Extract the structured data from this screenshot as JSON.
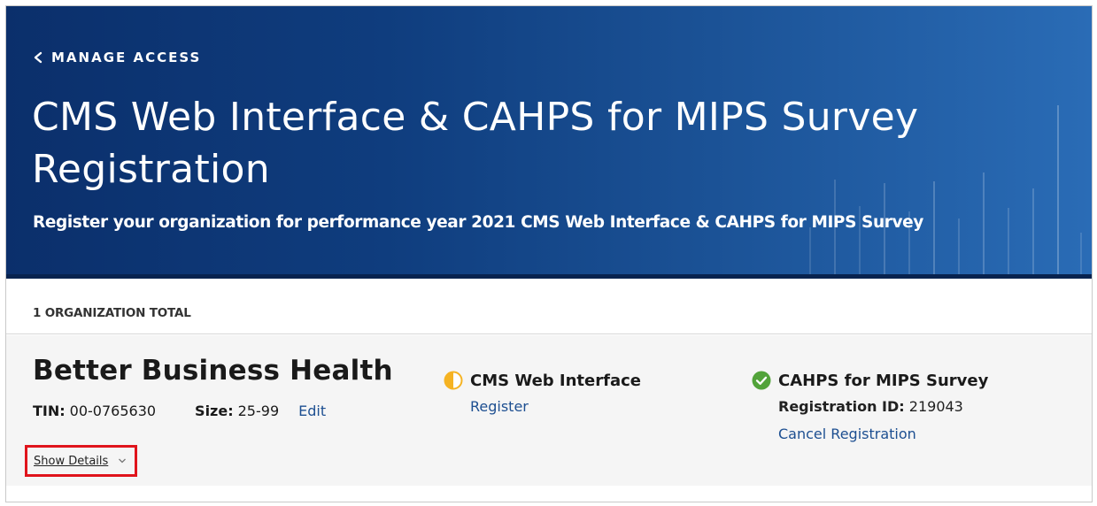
{
  "header": {
    "back_link": "MANAGE ACCESS",
    "title": "CMS Web Interface & CAHPS for MIPS Survey Registration",
    "subtitle": "Register your organization for performance year 2021 CMS Web Interface & CAHPS for MIPS Survey",
    "back_icon": "chevron-left-icon"
  },
  "summary": {
    "total_label": "1 ORGANIZATION TOTAL"
  },
  "organization": {
    "name": "Better Business Health",
    "tin_label": "TIN:",
    "tin_value": "00-0765630",
    "size_label": "Size:",
    "size_value": "25-99",
    "edit_label": "Edit",
    "show_details_label": "Show Details",
    "programs": [
      {
        "name": "CMS Web Interface",
        "status": "in-progress",
        "status_icon": "half-circle-icon",
        "status_color": "#f5b323",
        "action_label": "Register"
      },
      {
        "name": "CAHPS for MIPS Survey",
        "status": "registered",
        "status_icon": "check-circle-icon",
        "status_color": "#52a33a",
        "registration_id_label": "Registration ID:",
        "registration_id_value": "219043",
        "action_label": "Cancel Registration"
      }
    ]
  },
  "colors": {
    "hero_dark": "#0b2f6b",
    "hero_light": "#2a6cb6",
    "link": "#1d4f91",
    "highlight_box": "#e0141c"
  }
}
